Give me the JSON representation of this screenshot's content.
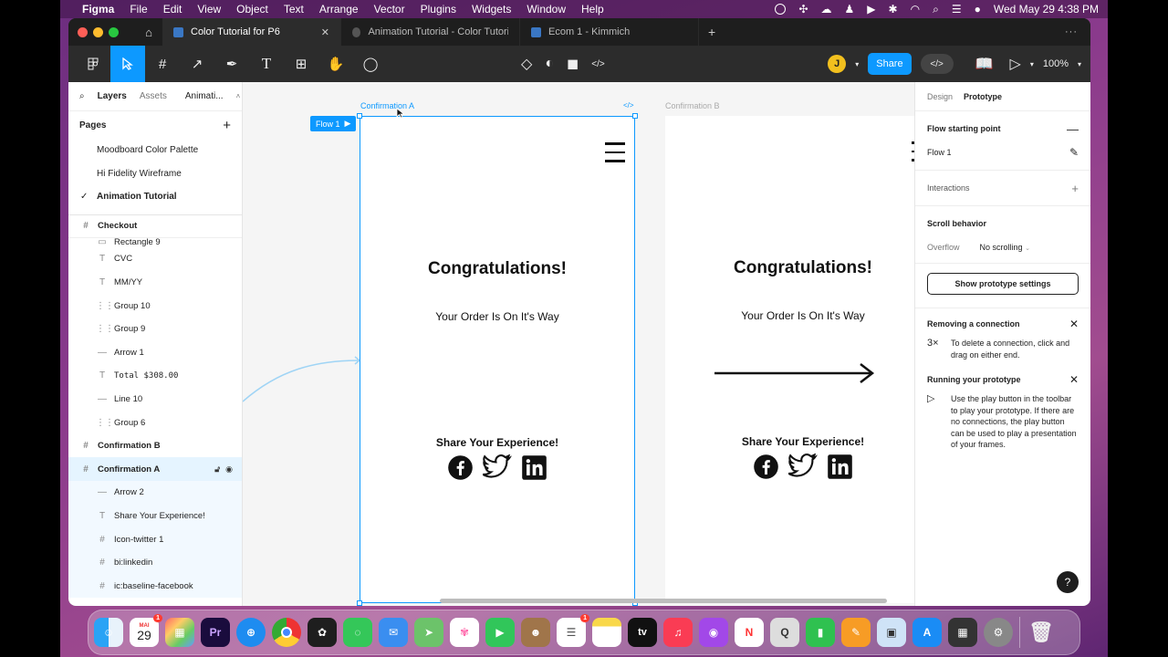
{
  "menubar": {
    "app_name": "Figma",
    "items": [
      "File",
      "Edit",
      "View",
      "Object",
      "Text",
      "Arrange",
      "Vector",
      "Plugins",
      "Widgets",
      "Window",
      "Help"
    ],
    "datetime": "Wed May 29  4:38 PM"
  },
  "tabs": [
    {
      "label": "Color Tutorial for P6"
    },
    {
      "label": "Animation Tutorial - Color Tutorial for"
    },
    {
      "label": "Ecom 1 - Kimmich"
    }
  ],
  "toolbar": {
    "avatar_initial": "J",
    "share_label": "Share",
    "dev_label": "</>",
    "zoom": "100%"
  },
  "left_panel": {
    "tabs": {
      "layers": "Layers",
      "assets": "Assets",
      "page": "Animati..."
    },
    "pages_title": "Pages",
    "pages": [
      "Moodboard Color Palette",
      "Hi Fidelity Wireframe",
      "Animation Tutorial"
    ],
    "checkout_label": "Checkout",
    "checkout_children": [
      "Rectangle 9",
      "CVC",
      "MM/YY",
      "Group 10",
      "Group 9",
      "Arrow 1",
      "Total $308.00",
      "Line 10",
      "Group 6"
    ],
    "confirmation_b": "Confirmation B",
    "confirmation_a": "Confirmation A",
    "confirmation_a_children": [
      "Arrow 2",
      "Share Your Experience!",
      "Icon-twitter 1",
      "bi:linkedin",
      "ic:baseline-facebook"
    ]
  },
  "canvas": {
    "frame_a_label": "Confirmation A",
    "frame_b_label": "Confirmation B",
    "flow_badge": "Flow 1",
    "frame_title": "Congratulations!",
    "frame_subtitle": "Your Order Is On It's Way",
    "frame_share": "Share Your Experience!"
  },
  "right_panel": {
    "tabs": {
      "design": "Design",
      "prototype": "Prototype"
    },
    "flow_start_title": "Flow starting point",
    "flow_name": "Flow 1",
    "interactions": "Interactions",
    "scroll_behavior": "Scroll behavior",
    "overflow_label": "Overflow",
    "overflow_value": "No scrolling",
    "show_settings": "Show prototype settings",
    "removing_title": "Removing a connection",
    "removing_text": "To delete a connection, click and drag on either end.",
    "running_title": "Running your prototype",
    "running_text": "Use the play button in the toolbar to play your prototype. If there are no connections, the play button can be used to play a presentation of your frames.",
    "help": "?"
  },
  "dock": {
    "calendar_month": "MAI",
    "calendar_day": "29",
    "calendar_badge": "1",
    "reminders_badge": "1",
    "tv_label": "tv"
  },
  "colors": {
    "accent": "#0d99ff",
    "toolbar_bg": "#2c2c2c",
    "canvas_bg": "#f5f5f5"
  }
}
